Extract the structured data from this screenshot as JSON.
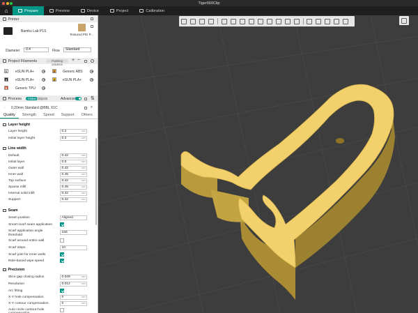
{
  "window": {
    "title": "Tiger660Clip"
  },
  "nav": {
    "tabs": [
      {
        "label": "Prepare",
        "active": true
      },
      {
        "label": "Preview",
        "active": false
      },
      {
        "label": "Device",
        "active": false
      },
      {
        "label": "Project",
        "active": false
      },
      {
        "label": "Calibration",
        "active": false
      }
    ]
  },
  "printer": {
    "section_label": "Printer",
    "name": "Bambu Lab P1S",
    "plate": "Textured PEI P...",
    "diameter_label": "Diameter",
    "diameter_value": "0.4",
    "flow_label": "Flow",
    "flow_value": "Standard"
  },
  "filaments": {
    "section_label": "Project Filaments",
    "flushing_label": "Flushing volumes",
    "items": [
      {
        "index": "1",
        "name": "eSUN PLA+",
        "color": "#e8e8e8"
      },
      {
        "index": "2",
        "name": "Generic ABS",
        "color": "#e8a03a"
      },
      {
        "index": "3",
        "name": "eSUN PLA+",
        "color": "#1a1a1a"
      },
      {
        "index": "4",
        "name": "eSUN PLA+",
        "color": "#f0c020"
      },
      {
        "index": "5",
        "name": "Generic TPU",
        "color": "#e05020"
      }
    ]
  },
  "process": {
    "section_label": "Process",
    "global_label": "Global",
    "objects_label": "Objects",
    "advanced_label": "Advanced",
    "preset": "0.20mm Standard @BBL X1C",
    "tabs": [
      "Quality",
      "Strength",
      "Speed",
      "Support",
      "Others"
    ],
    "active_tab": "Quality"
  },
  "quality": {
    "layer_height": {
      "title": "Layer height",
      "rows": [
        {
          "label": "Layer height",
          "value": "0.2",
          "unit": "mm"
        },
        {
          "label": "Initial layer height",
          "value": "0.2",
          "unit": "mm"
        }
      ]
    },
    "line_width": {
      "title": "Line width",
      "rows": [
        {
          "label": "Default",
          "value": "0.42",
          "unit": "mm"
        },
        {
          "label": "Initial layer",
          "value": "0.5",
          "unit": "mm"
        },
        {
          "label": "Outer wall",
          "value": "0.42",
          "unit": "mm"
        },
        {
          "label": "Inner wall",
          "value": "0.45",
          "unit": "mm"
        },
        {
          "label": "Top surface",
          "value": "0.42",
          "unit": "mm"
        },
        {
          "label": "Sparse infill",
          "value": "0.45",
          "unit": "mm"
        },
        {
          "label": "Internal solid infill",
          "value": "0.42",
          "unit": "mm"
        },
        {
          "label": "Support",
          "value": "0.42",
          "unit": "mm"
        }
      ]
    },
    "seam": {
      "title": "Seam",
      "position_label": "Seam position",
      "position_value": "Aligned",
      "smart_scarf_label": "Smart scarf seam application",
      "angle_label_1": "Scarf application angle",
      "angle_label_2": "threshold",
      "angle_value": "155",
      "angle_unit": "°",
      "entire_wall_label": "Scarf around entire wall",
      "steps_label": "Scarf steps",
      "steps_value": "10",
      "inner_walls_label": "Scarf joint for inner walls",
      "wipe_label": "Role-based wipe speed"
    },
    "precision": {
      "title": "Precision",
      "rows": [
        {
          "label": "Slice gap closing radius",
          "value": "0.049",
          "unit": "mm"
        },
        {
          "label": "Resolution",
          "value": "0.012",
          "unit": "mm"
        }
      ],
      "arc_label": "Arc fitting",
      "xy_hole_label": "X-Y hole compensation",
      "xy_hole_value": "0",
      "xy_contour_label": "X-Y contour compensation",
      "xy_contour_value": "0",
      "auto_circle_label": "Auto circle contour-hole",
      "auto_circle_label_2": "compensation"
    }
  },
  "viewport": {
    "model_color": "#f2d06b",
    "model_side_color": "#b89a3c"
  }
}
